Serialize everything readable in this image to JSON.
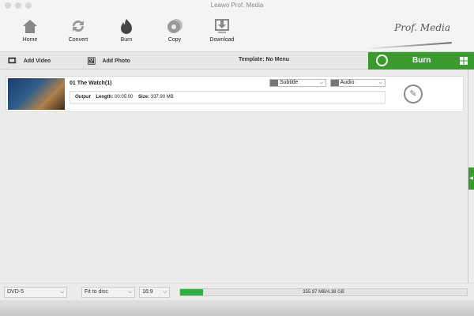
{
  "window": {
    "title": "Leawo Prof. Media"
  },
  "toolbar": {
    "items": [
      {
        "label": "Home",
        "icon": "home-icon"
      },
      {
        "label": "Convert",
        "icon": "convert-icon"
      },
      {
        "label": "Burn",
        "icon": "burn-icon"
      },
      {
        "label": "Copy",
        "icon": "copy-icon"
      },
      {
        "label": "Download",
        "icon": "download-icon"
      }
    ],
    "logo": "Prof. Media"
  },
  "actionbar": {
    "add_video": "Add Video",
    "add_photo": "Add Photo",
    "template": "Template: No Menu",
    "burn": "Burn"
  },
  "item": {
    "title": "01 The Watch(1)",
    "subtitle": "Subtitle",
    "audio": "Audio",
    "output_label": "Output",
    "length_label": "Length:",
    "length": "00:05:00",
    "size_label": "Size:",
    "size": "337.90 MB"
  },
  "bottom": {
    "disc": "DVD-5",
    "fit": "Fit to disc",
    "aspect": "16:9",
    "usage": "355.97 MB/4.38 GB",
    "usage_percent": 7.9
  },
  "colors": {
    "accent": "#3a9a2e",
    "progress": "#2db040"
  }
}
